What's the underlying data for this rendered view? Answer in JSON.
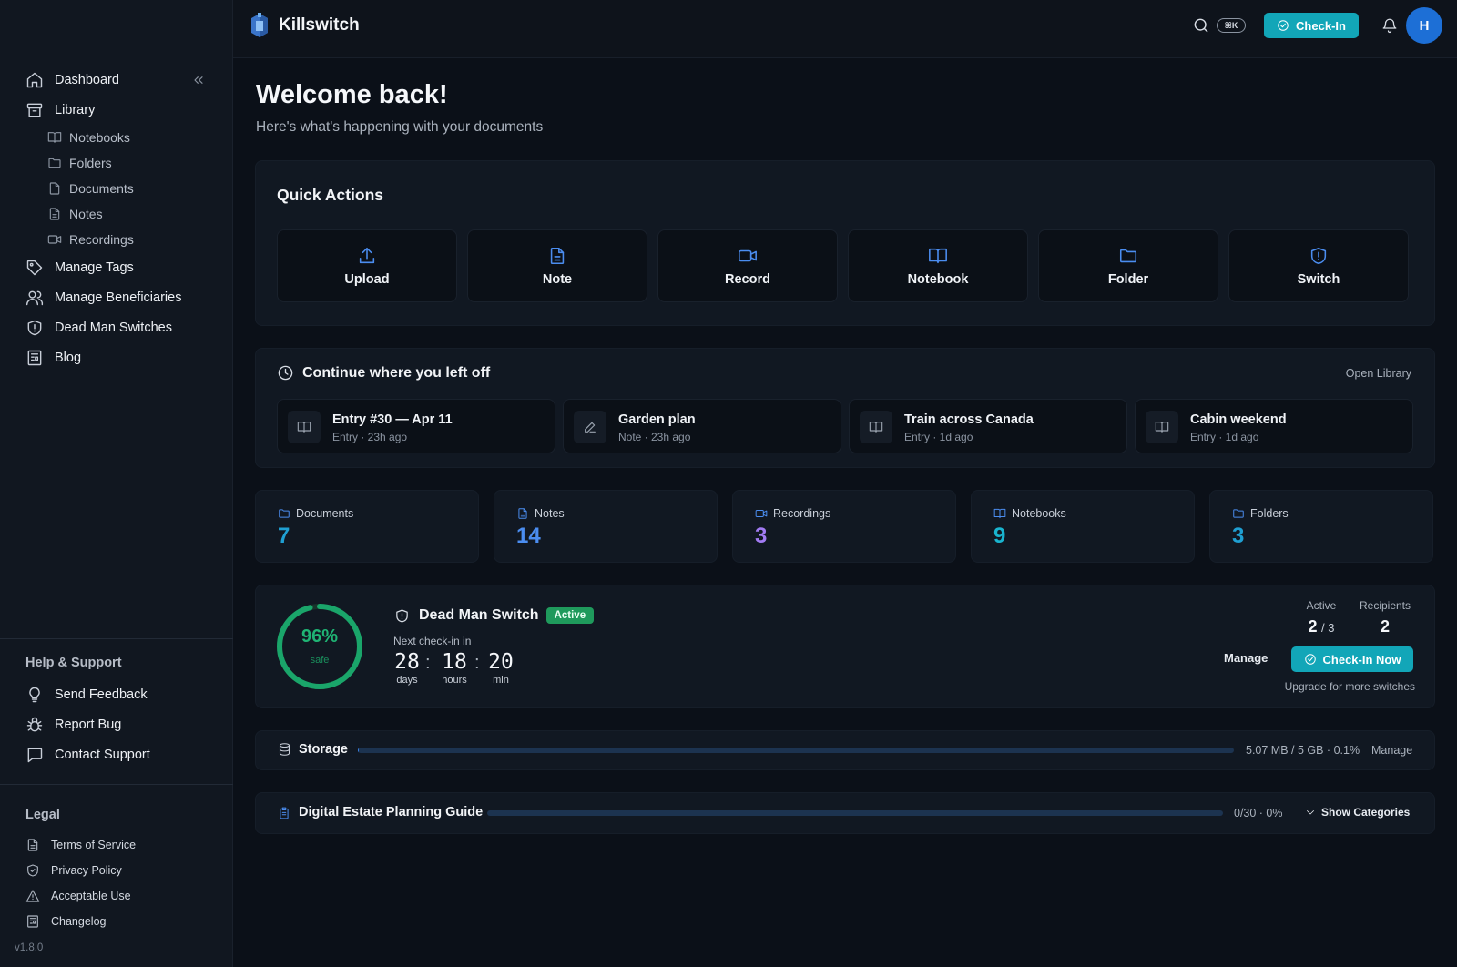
{
  "app": {
    "name": "Killswitch",
    "version": "v1.8.0"
  },
  "topbar": {
    "search_shortcut": "⌘K",
    "checkin_label": "Check-In",
    "avatar_initial": "H"
  },
  "sidebar": {
    "main": [
      {
        "label": "Dashboard",
        "icon": "home-icon"
      },
      {
        "label": "Library",
        "icon": "archive-icon"
      }
    ],
    "library_items": [
      {
        "label": "Notebooks",
        "icon": "book-icon"
      },
      {
        "label": "Folders",
        "icon": "folder-icon"
      },
      {
        "label": "Documents",
        "icon": "file-icon"
      },
      {
        "label": "Notes",
        "icon": "file-text-icon"
      },
      {
        "label": "Recordings",
        "icon": "video-icon"
      }
    ],
    "more": [
      {
        "label": "Manage Tags",
        "icon": "tag-icon"
      },
      {
        "label": "Manage Beneficiaries",
        "icon": "users-icon"
      },
      {
        "label": "Dead Man Switches",
        "icon": "shield-icon"
      },
      {
        "label": "Blog",
        "icon": "newspaper-icon"
      }
    ],
    "help_title": "Help & Support",
    "help": [
      {
        "label": "Send Feedback",
        "icon": "lightbulb-icon"
      },
      {
        "label": "Report Bug",
        "icon": "bug-icon"
      },
      {
        "label": "Contact Support",
        "icon": "message-icon"
      }
    ],
    "legal_title": "Legal",
    "legal": [
      {
        "label": "Terms of Service",
        "icon": "file-icon"
      },
      {
        "label": "Privacy Policy",
        "icon": "shield-icon"
      },
      {
        "label": "Acceptable Use",
        "icon": "alert-triangle-icon"
      },
      {
        "label": "Changelog",
        "icon": "newspaper-icon"
      }
    ]
  },
  "welcome": {
    "title": "Welcome back!",
    "subtitle": "Here's what's happening with your documents"
  },
  "quick_actions": {
    "title": "Quick Actions",
    "items": [
      {
        "label": "Upload",
        "icon": "upload-icon"
      },
      {
        "label": "Note",
        "icon": "file-text-icon"
      },
      {
        "label": "Record",
        "icon": "video-icon"
      },
      {
        "label": "Notebook",
        "icon": "book-open-icon"
      },
      {
        "label": "Folder",
        "icon": "folder-icon"
      },
      {
        "label": "Switch",
        "icon": "shield-alert-icon"
      }
    ]
  },
  "continue": {
    "title": "Continue where you left off",
    "link": "Open Library",
    "items": [
      {
        "title": "Entry #30 — Apr 11",
        "sub": "Entry · 23h ago",
        "icon": "book-icon"
      },
      {
        "title": "Garden plan",
        "sub": "Note · 23h ago",
        "icon": "edit-icon"
      },
      {
        "title": "Train across Canada",
        "sub": "Entry · 1d ago",
        "icon": "book-icon"
      },
      {
        "title": "Cabin weekend",
        "sub": "Entry · 1d ago",
        "icon": "book-icon"
      }
    ]
  },
  "stats": [
    {
      "label": "Documents",
      "value": "7",
      "color": "#1f9fd2",
      "icon": "folder-icon"
    },
    {
      "label": "Notes",
      "value": "14",
      "color": "#4b8df0",
      "icon": "file-text-icon"
    },
    {
      "label": "Recordings",
      "value": "3",
      "color": "#a27bf3",
      "icon": "video-icon"
    },
    {
      "label": "Notebooks",
      "value": "9",
      "color": "#19b4cf",
      "icon": "book-open-icon"
    },
    {
      "label": "Folders",
      "value": "3",
      "color": "#1f9fd2",
      "icon": "folder-icon"
    }
  ],
  "dms": {
    "percent_label": "96%",
    "percent": 96,
    "safe_label": "safe",
    "title": "Dead Man Switch",
    "badge": "Active",
    "next_label": "Next check-in in",
    "days": "28",
    "hours": "18",
    "minutes": "20",
    "days_label": "days",
    "hours_label": "hours",
    "min_label": "min",
    "active_label": "Active",
    "active_value": "2",
    "active_total": "/ 3",
    "recipients_label": "Recipients",
    "recipients_value": "2",
    "manage_label": "Manage",
    "checkin_label": "Check-In Now",
    "upgrade_label": "Upgrade for more switches"
  },
  "storage": {
    "label": "Storage",
    "usage": "5.07 MB / 5 GB · 0.1%",
    "fraction": 0.001,
    "manage": "Manage"
  },
  "guide": {
    "label": "Digital Estate Planning Guide",
    "progress": "0/30 · 0%",
    "fraction": 0,
    "toggle": "Show Categories"
  },
  "colors": {
    "accent": "#12a6b8",
    "green": "#1aa56a",
    "blue": "#4b8df0"
  }
}
